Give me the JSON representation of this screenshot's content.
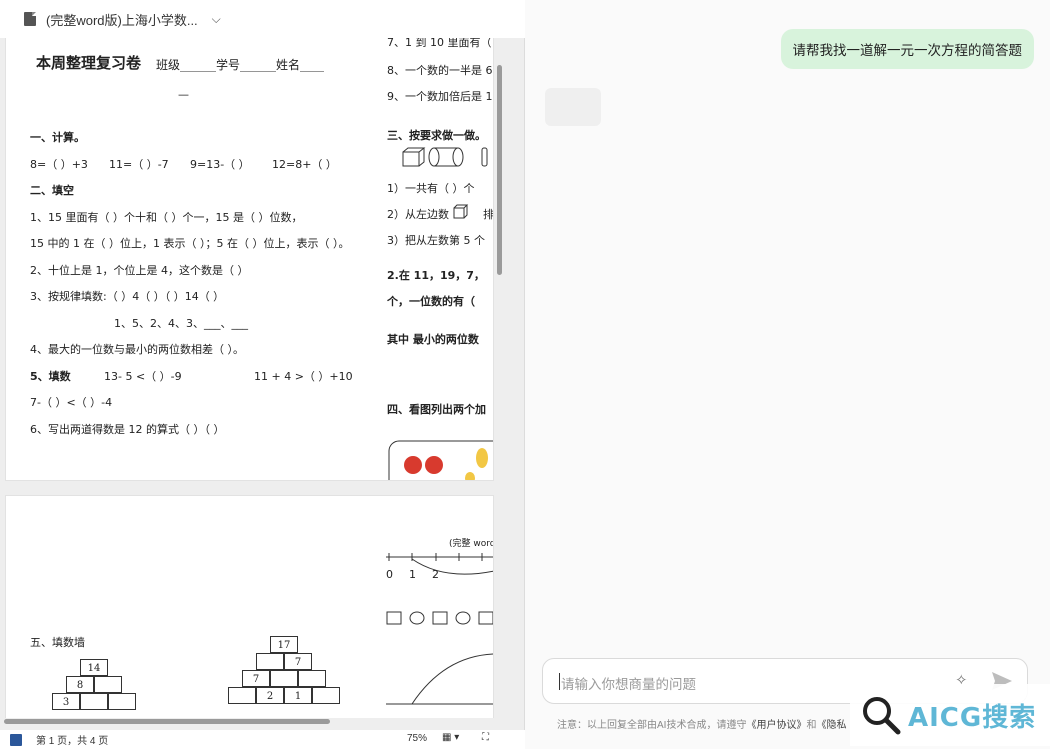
{
  "window": {
    "doc_tab_title": "(完整word版)上海小学数..."
  },
  "doc": {
    "title": "本周整理复习卷",
    "info": "班级______学号______姓名____",
    "info_cont": "—",
    "s1_heading": "一、计算。",
    "s1_items": [
      "8=（  ）+3",
      "11=（  ）-7",
      "9=13-（  ）",
      "12=8+（  ）"
    ],
    "s2_heading": "二、填空",
    "q1a": "1、15 里面有（     ）个十和（     ）个一，15 是（ ）位数，",
    "q1b": "15 中的 1 在（ ）位上，1 表示（ ）；5 在（ ）位上，表示（ ）。",
    "q2": "2、十位上是 1，个位上是 4，这个数是（ ）",
    "q3": "3、按规律填数:（ ）4（ ）（ ）14（ ）",
    "q3b": "1、5、2、4、3、___、___",
    "q4": "4、最大的一位数与最小的两位数相差（      ）。",
    "q5_label": "5、填数",
    "q5a": "13-  5 <（   ）-9",
    "q5b": "11 + 4 >（   ）+10",
    "q5c": "7-（   ）<（   ）-4",
    "q6": "6、写出两道得数是 12 的算式（               ）（               ）",
    "r7": "7、1 到 10 里面有（",
    "r8": "8、一个数的一半是 6",
    "r9": "9、一个数加倍后是 1(",
    "s3_heading": "三、按要求做一做。",
    "r3_1": "1）一共有（   ）个",
    "r3_2": "2）从左边数",
    "r3_2b": "排",
    "r3_3": "3）把从左数第 5 个",
    "r_q2": "2.在 11，19，7，",
    "r_q2b": "个，一位数的有（",
    "r_q2c": "其中  最小的两位数",
    "s4_heading": "四、看图列出两个加",
    "p2_header": "(完整 word",
    "p2_nums": [
      "0",
      "1",
      "2"
    ],
    "s5_heading": "五、填数墙",
    "wall1": [
      "14",
      "8",
      "3"
    ],
    "wall2": [
      "17",
      "7",
      "7",
      "2",
      "1"
    ]
  },
  "status": {
    "page_info": "第 1 页，共 4 页",
    "zoom": "75%"
  },
  "chat": {
    "user_message": "请帮我找一道解一元一次方程的简答题",
    "input_placeholder": "请输入你想商量的问题",
    "notice_prefix": "注意：以上回复全部由AI技术合成，请遵守",
    "notice_link1": "《用户协议》",
    "notice_and": "和",
    "notice_link2": "《隐私",
    "watermark": "AICG搜索"
  }
}
